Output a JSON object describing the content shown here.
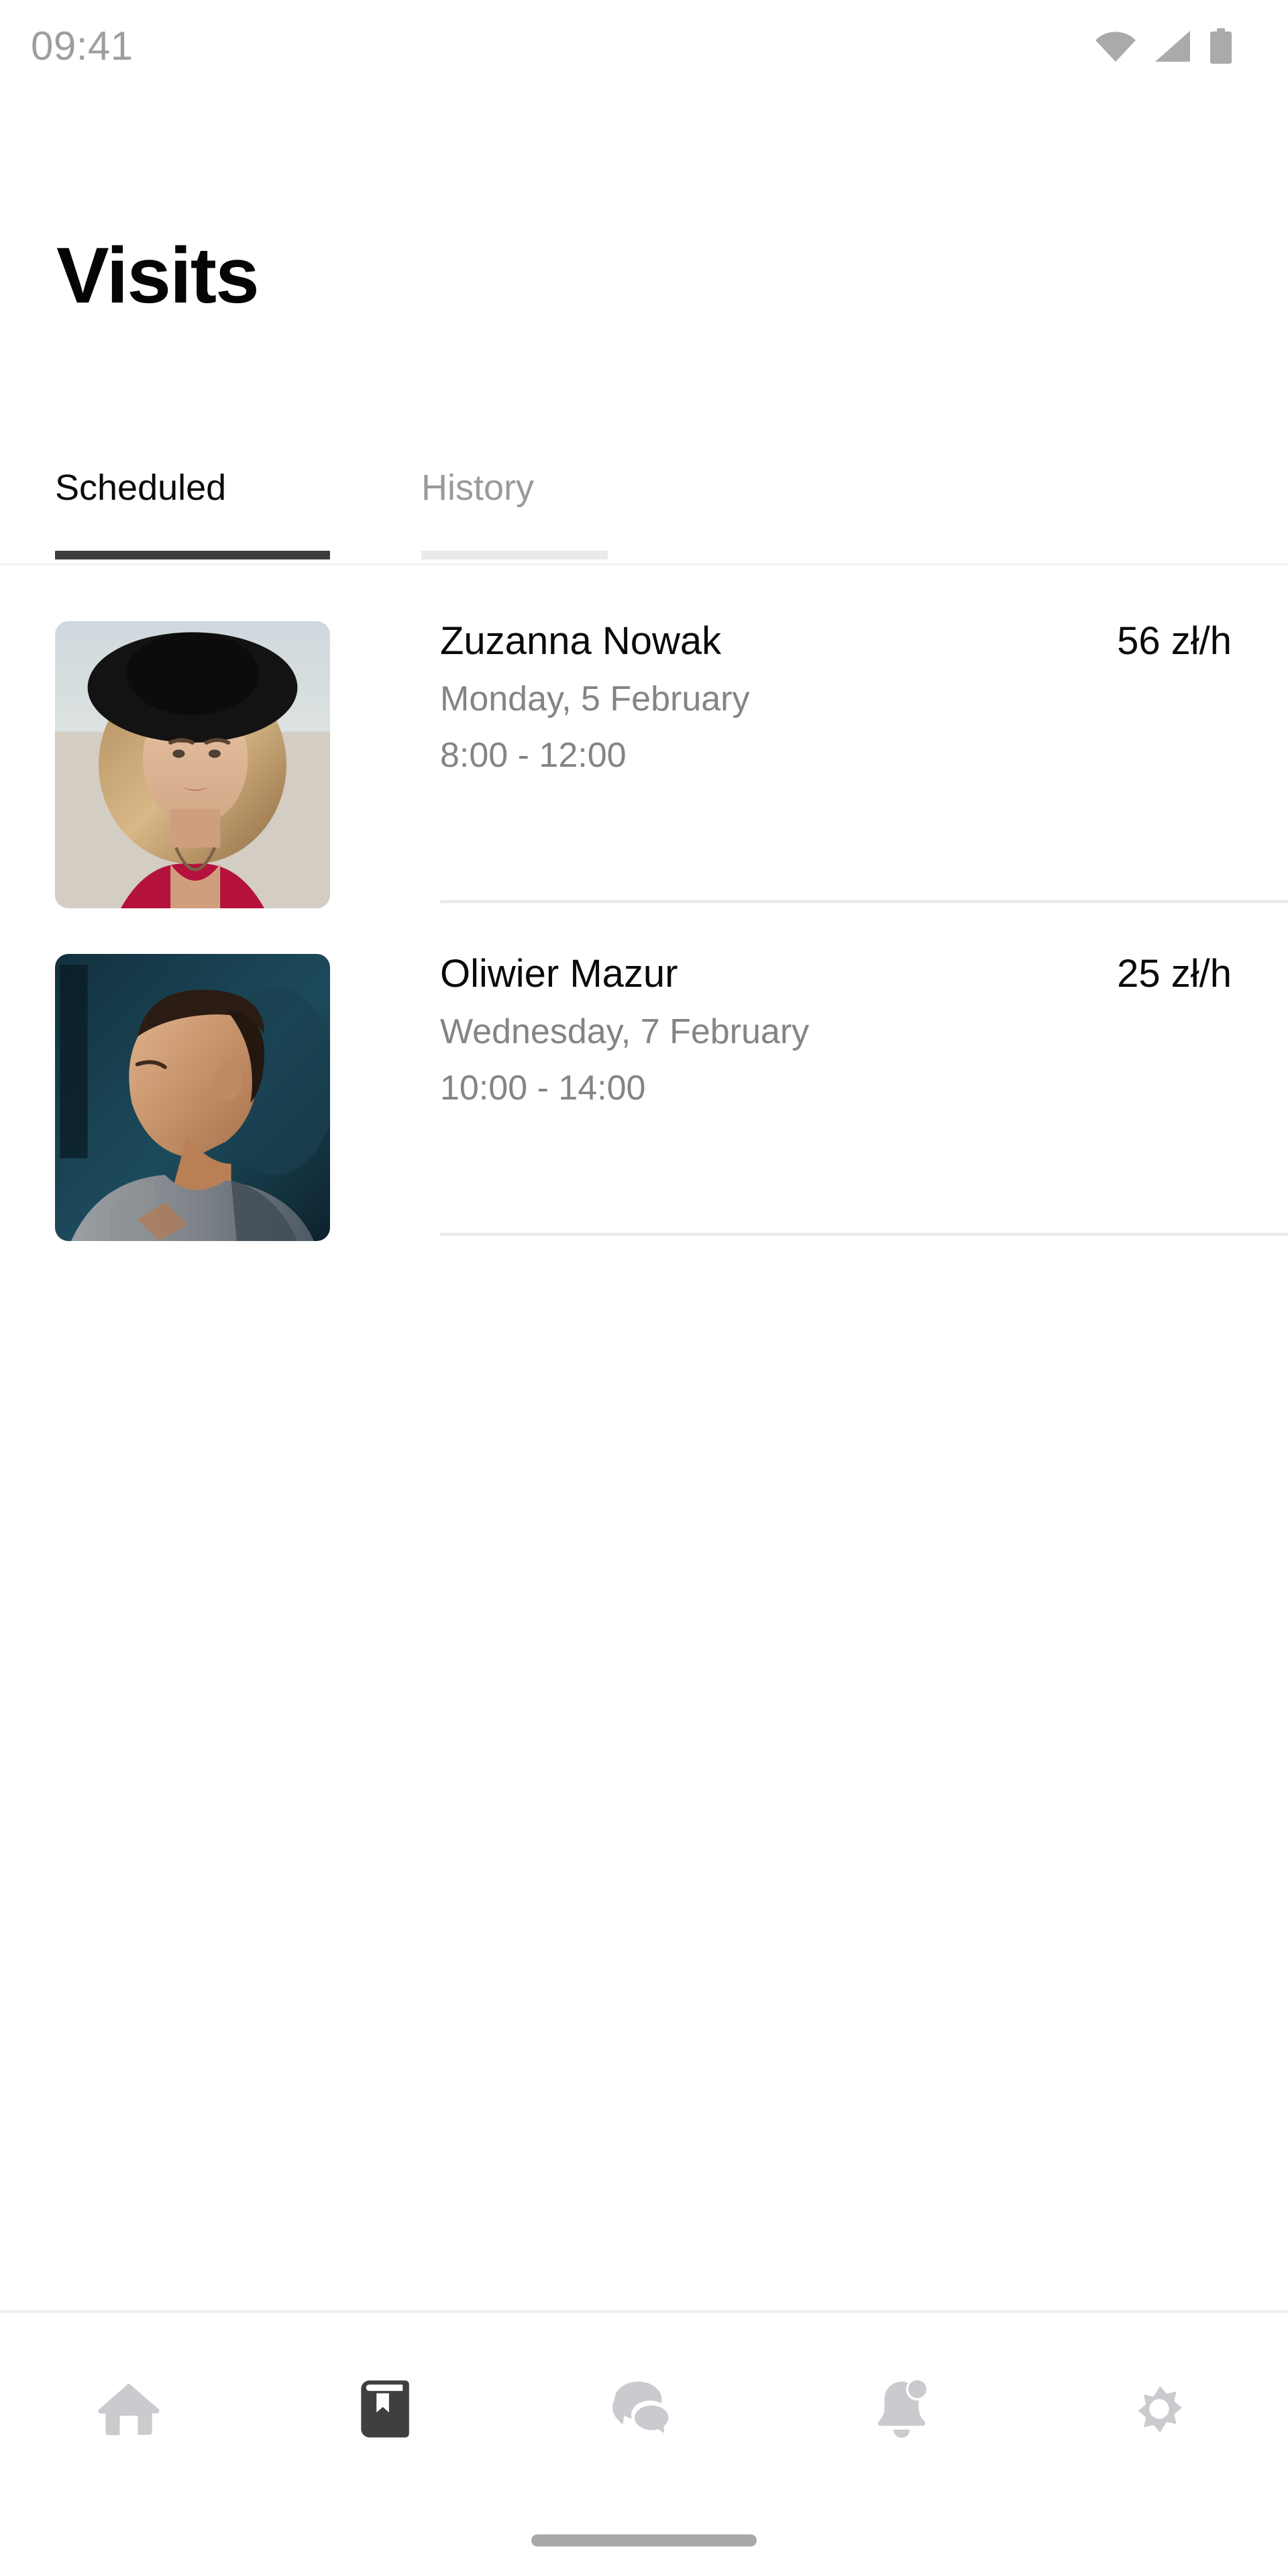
{
  "status_bar": {
    "time": "09:41",
    "icons": [
      "wifi-icon",
      "cellular-signal-icon",
      "battery-icon"
    ],
    "icon_color": "#aaaaaa"
  },
  "header": {
    "title": "Visits"
  },
  "tabs": {
    "active": "Scheduled",
    "items": [
      {
        "label": "Scheduled",
        "active": true,
        "underline_color": "#3d3d3d"
      },
      {
        "label": "History",
        "active": false,
        "underline_color": "#eaeaea"
      }
    ]
  },
  "visits": [
    {
      "avatar_name": "avatar-zuzanna-nowak",
      "name": "Zuzanna Nowak",
      "rate": "56 zł/h",
      "date": "Monday, 5 February",
      "time": "8:00 - 12:00"
    },
    {
      "avatar_name": "avatar-oliwier-mazur",
      "name": "Oliwier Mazur",
      "rate": "25 zł/h",
      "date": "Wednesday, 7 February",
      "time": "10:00 - 14:00"
    }
  ],
  "bottom_nav": {
    "active_index": 1,
    "items": [
      {
        "icon": "home-icon",
        "label": "Home",
        "active": false
      },
      {
        "icon": "book-bookmark-icon",
        "label": "Visits",
        "active": true
      },
      {
        "icon": "chat-bubbles-icon",
        "label": "Messages",
        "active": false
      },
      {
        "icon": "bell-notification-icon",
        "label": "Notifications",
        "active": false
      },
      {
        "icon": "gear-icon",
        "label": "Settings",
        "active": false
      }
    ],
    "inactive_color": "#cbcbcf",
    "active_color": "#3f3f3f"
  },
  "system": {
    "home_indicator": "home-indicator-bar"
  }
}
